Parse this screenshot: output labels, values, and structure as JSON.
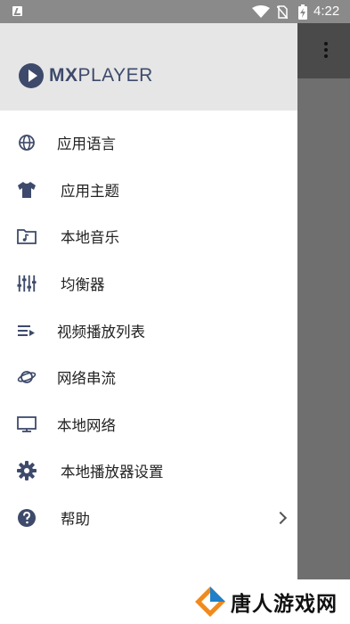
{
  "status_bar": {
    "time": "4:22",
    "icons": [
      "notification-icon",
      "wifi-icon",
      "no-sim-icon",
      "battery-charging-icon"
    ]
  },
  "app_toolbar": {
    "overflow_icon": "more-vert-icon"
  },
  "drawer": {
    "logo_prefix": "MX",
    "logo_suffix": "PLAYER",
    "items": [
      {
        "label": "应用语言",
        "icon": "globe-icon"
      },
      {
        "label": "应用主题",
        "icon": "tshirt-icon"
      },
      {
        "label": "本地音乐",
        "icon": "music-folder-icon"
      },
      {
        "label": "均衡器",
        "icon": "equalizer-icon"
      },
      {
        "label": "视频播放列表",
        "icon": "playlist-icon"
      },
      {
        "label": "网络串流",
        "icon": "network-stream-icon"
      },
      {
        "label": "本地网络",
        "icon": "monitor-icon"
      },
      {
        "label": "本地播放器设置",
        "icon": "gear-icon"
      },
      {
        "label": "帮助",
        "icon": "help-icon"
      }
    ]
  },
  "watermark": {
    "text": "唐人游戏网"
  },
  "colors": {
    "accent": "#3e4a6b",
    "drawer_header": "#e6e6e6",
    "scrim": "#6f6f6f"
  }
}
